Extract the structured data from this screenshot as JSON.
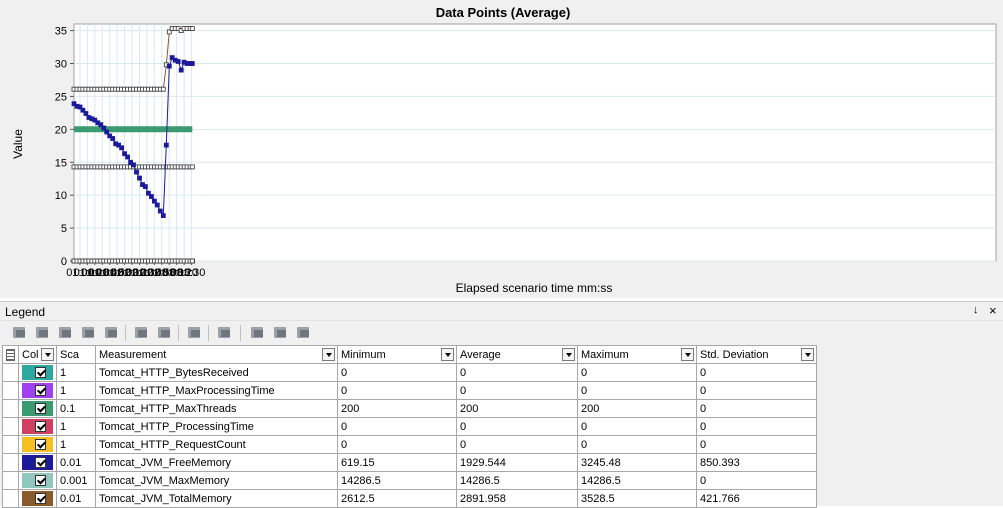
{
  "chart_data": {
    "type": "line",
    "title": "Data Points (Average)",
    "xlabel": "Elapsed scenario time mm:ss",
    "ylabel": "Value",
    "xlim": [
      52,
      1291
    ],
    "ylim": [
      0,
      36
    ],
    "x_ticks": [
      "01:00",
      "01:10",
      "01:20",
      "01:30",
      "01:40",
      "01:50",
      "02:00",
      "02:10",
      "02:20",
      "02:30",
      "02:40",
      "02:50",
      "03:00",
      "03:10",
      "03:20",
      "03:30"
    ],
    "y_ticks": [
      "0",
      "5",
      "10",
      "15",
      "20",
      "25",
      "30",
      "35"
    ],
    "grid": true,
    "x": [
      "00:52",
      "00:56",
      "01:00",
      "01:04",
      "01:08",
      "01:12",
      "01:16",
      "01:20",
      "01:24",
      "01:28",
      "01:32",
      "01:36",
      "01:40",
      "01:44",
      "01:48",
      "01:52",
      "01:56",
      "02:00",
      "02:04",
      "02:08",
      "02:12",
      "02:16",
      "02:20",
      "02:24",
      "02:28",
      "02:32",
      "02:36",
      "02:40",
      "02:44",
      "02:48",
      "02:52",
      "02:56",
      "03:00",
      "03:04",
      "03:08",
      "03:12",
      "03:16",
      "03:20",
      "03:24",
      "03:28",
      "03:31"
    ],
    "series": [
      {
        "name": "Tomcat_HTTP_BytesReceived",
        "color": "#2fa8a0",
        "values": [
          0,
          0,
          0,
          0,
          0,
          0,
          0,
          0,
          0,
          0,
          0,
          0,
          0,
          0,
          0,
          0,
          0,
          0,
          0,
          0,
          0,
          0,
          0,
          0,
          0,
          0,
          0,
          0,
          0,
          0,
          0,
          0,
          0,
          0,
          0,
          0,
          0,
          0,
          0,
          0,
          0
        ]
      },
      {
        "name": "Tomcat_HTTP_MaxProcessingTime",
        "color": "#a040f0",
        "values": [
          0,
          0,
          0,
          0,
          0,
          0,
          0,
          0,
          0,
          0,
          0,
          0,
          0,
          0,
          0,
          0,
          0,
          0,
          0,
          0,
          0,
          0,
          0,
          0,
          0,
          0,
          0,
          0,
          0,
          0,
          0,
          0,
          0,
          0,
          0,
          0,
          0,
          0,
          0,
          0,
          0
        ]
      },
      {
        "name": "Tomcat_HTTP_MaxThreads",
        "color": "#3a9a70",
        "values": [
          20,
          20,
          20,
          20,
          20,
          20,
          20,
          20,
          20,
          20,
          20,
          20,
          20,
          20,
          20,
          20,
          20,
          20,
          20,
          20,
          20,
          20,
          20,
          20,
          20,
          20,
          20,
          20,
          20,
          20,
          20,
          20,
          20,
          20,
          20,
          20,
          20,
          20,
          20,
          20,
          20
        ]
      },
      {
        "name": "Tomcat_HTTP_ProcessingTime",
        "color": "#d04060",
        "values": [
          0,
          0,
          0,
          0,
          0,
          0,
          0,
          0,
          0,
          0,
          0,
          0,
          0,
          0,
          0,
          0,
          0,
          0,
          0,
          0,
          0,
          0,
          0,
          0,
          0,
          0,
          0,
          0,
          0,
          0,
          0,
          0,
          0,
          0,
          0,
          0,
          0,
          0,
          0,
          0,
          0
        ]
      },
      {
        "name": "Tomcat_HTTP_RequestCount",
        "color": "#f5c020",
        "values": [
          0,
          0,
          0,
          0,
          0,
          0,
          0,
          0,
          0,
          0,
          0,
          0,
          0,
          0,
          0,
          0,
          0,
          0,
          0,
          0,
          0,
          0,
          0,
          0,
          0,
          0,
          0,
          0,
          0,
          0,
          0,
          0,
          0,
          0,
          0,
          0,
          0,
          0,
          0,
          0,
          0
        ]
      },
      {
        "name": "Tomcat_JVM_FreeMemory",
        "color": "#1a1a9a",
        "values": [
          23.9,
          23.5,
          23.4,
          22.9,
          22.4,
          21.8,
          21.6,
          21.4,
          21.0,
          20.7,
          20.2,
          19.6,
          19.0,
          18.6,
          17.8,
          17.6,
          17.2,
          16.3,
          15.8,
          15.0,
          14.6,
          13.5,
          12.6,
          11.6,
          11.3,
          10.3,
          9.8,
          9.1,
          8.5,
          7.6,
          6.9,
          17.6,
          29.6,
          30.9,
          30.5,
          30.3,
          29.0,
          30.2,
          30.0,
          30.0,
          30.0
        ]
      },
      {
        "name": "Tomcat_JVM_MaxMemory",
        "color": "#90c8c0",
        "values": [
          14.3,
          14.3,
          14.3,
          14.3,
          14.3,
          14.3,
          14.3,
          14.3,
          14.3,
          14.3,
          14.3,
          14.3,
          14.3,
          14.3,
          14.3,
          14.3,
          14.3,
          14.3,
          14.3,
          14.3,
          14.3,
          14.3,
          14.3,
          14.3,
          14.3,
          14.3,
          14.3,
          14.3,
          14.3,
          14.3,
          14.3,
          14.3,
          14.3,
          14.3,
          14.3,
          14.3,
          14.3,
          14.3,
          14.3,
          14.3,
          14.3
        ]
      },
      {
        "name": "Tomcat_JVM_TotalMemory",
        "color": "#8b5a2b",
        "values": [
          26.1,
          26.1,
          26.1,
          26.1,
          26.1,
          26.1,
          26.1,
          26.1,
          26.1,
          26.1,
          26.1,
          26.1,
          26.1,
          26.1,
          26.1,
          26.1,
          26.1,
          26.1,
          26.1,
          26.1,
          26.1,
          26.1,
          26.1,
          26.1,
          26.1,
          26.1,
          26.1,
          26.1,
          26.1,
          26.1,
          26.1,
          29.8,
          34.8,
          35.3,
          35.3,
          35.3,
          35.0,
          35.3,
          35.3,
          35.3,
          35.3
        ]
      }
    ]
  },
  "legend": {
    "title": "Legend",
    "pin_glyph": "↓",
    "close_glyph": "×",
    "columns": {
      "color": "Col",
      "scale": "Sca",
      "measurement": "Measurement",
      "minimum": "Minimum",
      "average": "Average",
      "maximum": "Maximum",
      "std": "Std. Deviation"
    },
    "rows": [
      {
        "color": "#2fa8a0",
        "checked": true,
        "scale": "1",
        "measurement": "Tomcat_HTTP_BytesReceived",
        "minimum": "0",
        "average": "0",
        "maximum": "0",
        "std": "0"
      },
      {
        "color": "#a040f0",
        "checked": true,
        "scale": "1",
        "measurement": "Tomcat_HTTP_MaxProcessingTime",
        "minimum": "0",
        "average": "0",
        "maximum": "0",
        "std": "0"
      },
      {
        "color": "#3a9a70",
        "checked": true,
        "scale": "0.1",
        "measurement": "Tomcat_HTTP_MaxThreads",
        "minimum": "200",
        "average": "200",
        "maximum": "200",
        "std": "0"
      },
      {
        "color": "#d04060",
        "checked": true,
        "scale": "1",
        "measurement": "Tomcat_HTTP_ProcessingTime",
        "minimum": "0",
        "average": "0",
        "maximum": "0",
        "std": "0"
      },
      {
        "color": "#f5c020",
        "checked": true,
        "scale": "1",
        "measurement": "Tomcat_HTTP_RequestCount",
        "minimum": "0",
        "average": "0",
        "maximum": "0",
        "std": "0"
      },
      {
        "color": "#1a1a9a",
        "checked": true,
        "scale": "0.01",
        "measurement": "Tomcat_JVM_FreeMemory",
        "minimum": "619.15",
        "average": "1929.544",
        "maximum": "3245.48",
        "std": "850.393"
      },
      {
        "color": "#90c8c0",
        "checked": true,
        "scale": "0.001",
        "measurement": "Tomcat_JVM_MaxMemory",
        "minimum": "14286.5",
        "average": "14286.5",
        "maximum": "14286.5",
        "std": "0"
      },
      {
        "color": "#8b5a2b",
        "checked": true,
        "scale": "0.01",
        "measurement": "Tomcat_JVM_TotalMemory",
        "minimum": "2612.5",
        "average": "2891.958",
        "maximum": "3528.5",
        "std": "421.766"
      }
    ]
  },
  "toolbar": {
    "buttons": [
      "show-all-icon",
      "hide-all-icon",
      "show-selected-icon",
      "hide-selected-icon",
      "filter-icon",
      "configure-icon",
      "measurement-options-icon",
      "auto-correlate-icon",
      "columns-icon",
      "export-icon",
      "sort-icon",
      "properties-icon"
    ]
  }
}
